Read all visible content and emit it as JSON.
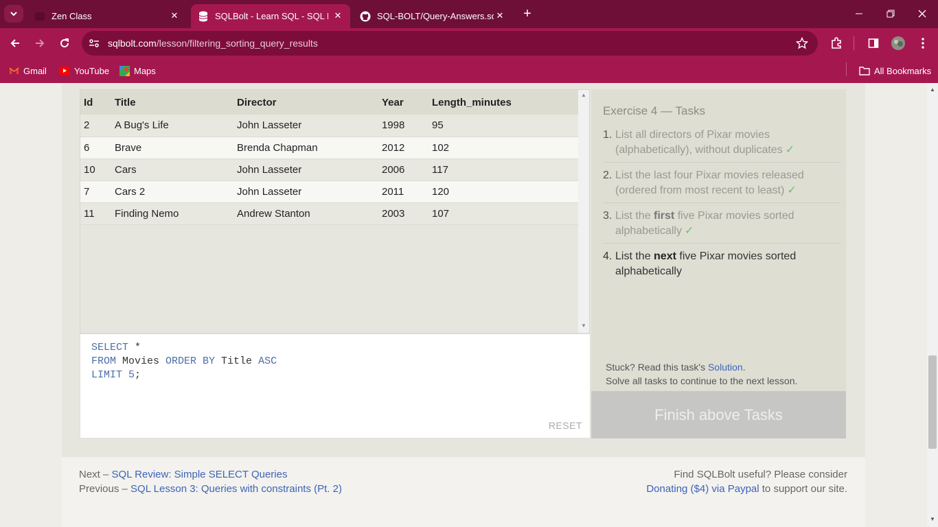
{
  "browser": {
    "tabs": [
      {
        "title": "Zen Class"
      },
      {
        "title": "SQLBolt - Learn SQL - SQL Lesson"
      },
      {
        "title": "SQL-BOLT/Query-Answers.sql at"
      }
    ],
    "url_host": "sqlbolt.com",
    "url_path": "/lesson/filtering_sorting_query_results",
    "bookmarks": [
      "Gmail",
      "YouTube",
      "Maps"
    ],
    "all_bookmarks": "All Bookmarks"
  },
  "results": {
    "columns": [
      "Id",
      "Title",
      "Director",
      "Year",
      "Length_minutes"
    ],
    "rows": [
      [
        "2",
        "A Bug's Life",
        "John Lasseter",
        "1998",
        "95"
      ],
      [
        "6",
        "Brave",
        "Brenda Chapman",
        "2012",
        "102"
      ],
      [
        "10",
        "Cars",
        "John Lasseter",
        "2006",
        "117"
      ],
      [
        "7",
        "Cars 2",
        "John Lasseter",
        "2011",
        "120"
      ],
      [
        "11",
        "Finding Nemo",
        "Andrew Stanton",
        "2003",
        "107"
      ]
    ]
  },
  "editor": {
    "line1_kw": "SELECT",
    "line1_rest": " *",
    "line2_kw1": "FROM",
    "line2_tbl": " Movies ",
    "line2_kw2": "ORDER BY",
    "line2_col": " Title ",
    "line2_kw3": "ASC",
    "line3_kw": "LIMIT",
    "line3_num": " 5",
    "line3_end": ";",
    "reset_label": "RESET"
  },
  "tasks": {
    "title": "Exercise 4 — Tasks",
    "items": [
      {
        "num": "1.",
        "pre": "List all directors of Pixar movies (alphabetically), without duplicates",
        "bold": "",
        "post": "",
        "done": true
      },
      {
        "num": "2.",
        "pre": "List the last four Pixar movies released (ordered from most recent to least)",
        "bold": "",
        "post": "",
        "done": true
      },
      {
        "num": "3.",
        "pre": "List the ",
        "bold": "first",
        "post": " five Pixar movies sorted alphabetically",
        "done": true
      },
      {
        "num": "4.",
        "pre": "List the ",
        "bold": "next",
        "post": " five Pixar movies sorted alphabetically",
        "done": false
      }
    ],
    "check_glyph": "✓",
    "stuck_text": "Stuck? Read this task's ",
    "stuck_link": "Solution",
    "stuck_end": ".",
    "solve_all": "Solve all tasks to continue to the next lesson.",
    "finish_label": "Finish above Tasks"
  },
  "footer": {
    "next_prefix": "Next – ",
    "next_link": "SQL Review: Simple SELECT Queries",
    "prev_prefix": "Previous – ",
    "prev_link": "SQL Lesson 3: Queries with constraints (Pt. 2)",
    "support_line1": "Find SQLBolt useful? Please consider",
    "support_link": "Donating ($4) via Paypal",
    "support_end": " to support our site."
  },
  "colors": {
    "tabbar": "#6e0f38",
    "toolbar": "#a5184f",
    "link": "#3d63b8",
    "check": "#6bbf73"
  }
}
